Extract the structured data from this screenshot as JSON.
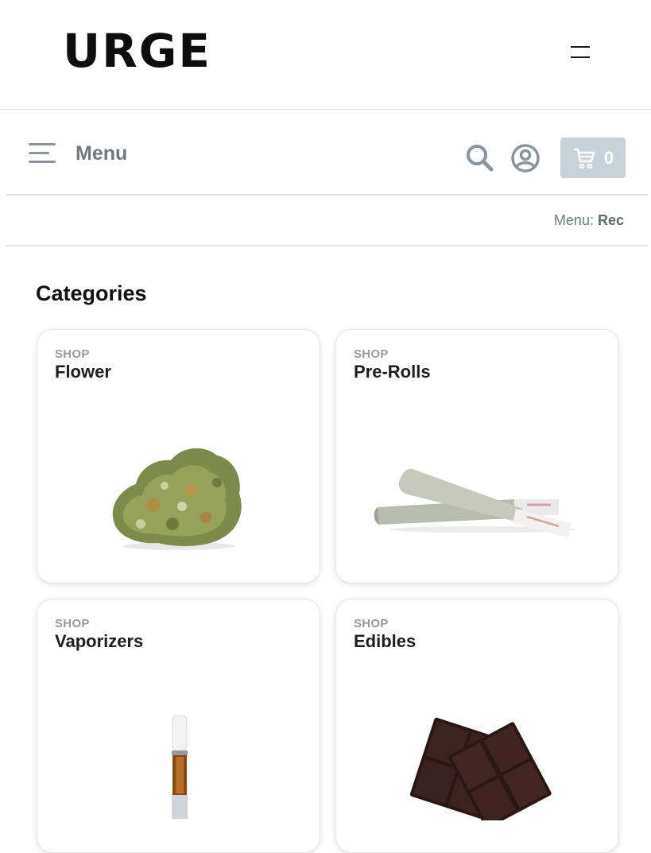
{
  "brand": {
    "logo_text": "URGE"
  },
  "nav": {
    "menu_label": "Menu",
    "cart_count": "0",
    "icons": [
      "menu-icon",
      "search-icon",
      "user-icon",
      "cart-icon"
    ]
  },
  "menu_type": {
    "label": "Menu:",
    "value": "Rec"
  },
  "categories": {
    "title": "Categories",
    "items": [
      {
        "kicker": "SHOP",
        "name": "Flower"
      },
      {
        "kicker": "SHOP",
        "name": "Pre-Rolls"
      },
      {
        "kicker": "SHOP",
        "name": "Vaporizers"
      },
      {
        "kicker": "SHOP",
        "name": "Edibles"
      }
    ]
  },
  "colors": {
    "cart_button": "#c8d2d9",
    "nav_text": "#6f7a82",
    "card_border": "#e4e4e4"
  }
}
